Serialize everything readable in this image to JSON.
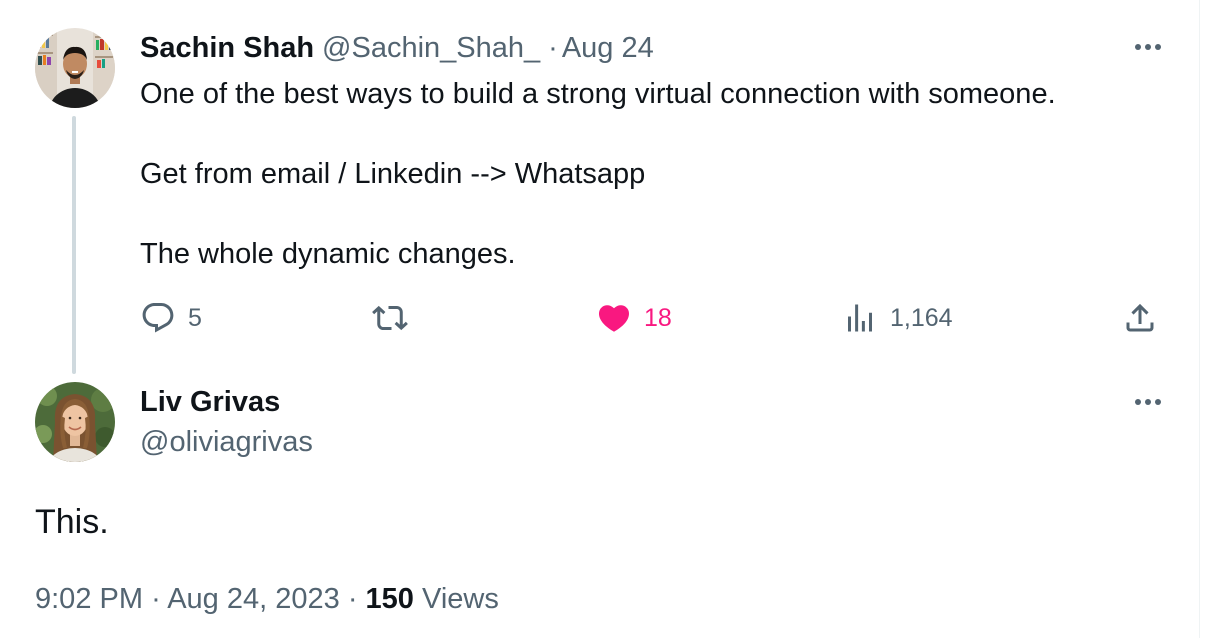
{
  "parent_tweet": {
    "author_name": "Sachin Shah",
    "handle": "@Sachin_Shah_",
    "separator": "·",
    "date": "Aug 24",
    "lines": [
      "One of the best ways to build a strong virtual connection with someone.",
      "Get from email / Linkedin --> Whatsapp",
      "The whole dynamic changes."
    ],
    "stats": {
      "replies": "5",
      "retweets": "",
      "likes": "18",
      "views": "1,164"
    },
    "liked": true
  },
  "reply_tweet": {
    "author_name": "Liv Grivas",
    "handle": "@oliviagrivas",
    "text": "This.",
    "time": "9:02 PM",
    "separator": "·",
    "date": "Aug 24, 2023",
    "views_count": "150",
    "views_label": "Views"
  },
  "icons": {
    "reply": "speech-bubble-icon",
    "retweet": "retweet-arrows-icon",
    "like": "heart-icon",
    "views": "bar-chart-icon",
    "share": "upload-arrow-icon",
    "more": "ellipsis-icon"
  },
  "colors": {
    "text_primary": "#0f1419",
    "text_secondary": "#536471",
    "like_pink": "#f91880",
    "thread_line": "#cfd9de"
  }
}
